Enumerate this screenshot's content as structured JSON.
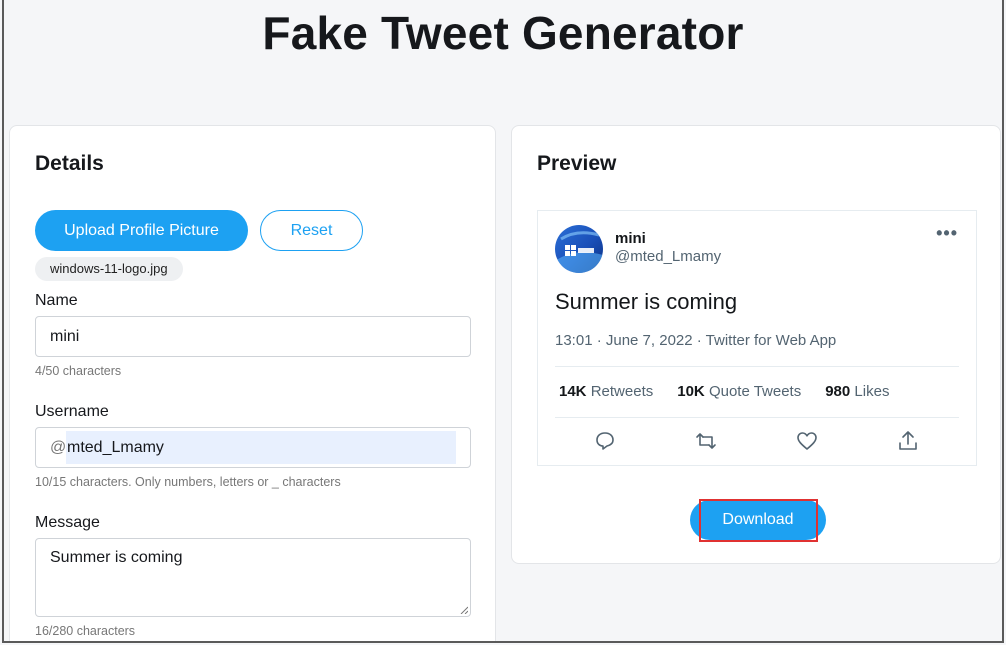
{
  "page": {
    "title": "Fake Tweet Generator"
  },
  "details": {
    "heading": "Details",
    "upload_label": "Upload Profile Picture",
    "reset_label": "Reset",
    "file_name": "windows-11-logo.jpg",
    "name": {
      "label": "Name",
      "value": "mini",
      "hint": "4/50 characters"
    },
    "username": {
      "label": "Username",
      "prefix": "@",
      "value": "mted_Lmamy",
      "hint": "10/15 characters. Only numbers, letters or _ characters"
    },
    "message": {
      "label": "Message",
      "value": "Summer is coming",
      "hint": "16/280 characters"
    }
  },
  "preview": {
    "heading": "Preview",
    "tweet": {
      "display_name": "mini",
      "handle": "@mted_Lmamy",
      "more": "•••",
      "message": "Summer is coming",
      "meta": "13:01 · June 7, 2022 · Twitter for Web App",
      "retweets_count": "14K",
      "retweets_label": "Retweets",
      "quotes_count": "10K",
      "quotes_label": "Quote Tweets",
      "likes_count": "980",
      "likes_label": "Likes",
      "actions": [
        "reply-icon",
        "retweet-icon",
        "like-icon",
        "share-icon"
      ]
    },
    "download_label": "Download"
  },
  "colors": {
    "accent": "#1da1f2",
    "highlight": "#e03131"
  }
}
